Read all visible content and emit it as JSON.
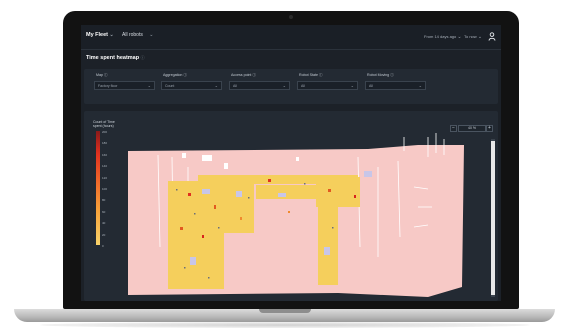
{
  "app": {
    "nav": {
      "fleet": "My Fleet",
      "robots": "All robots",
      "range_from": "From 14 days ago",
      "range_to": "To now"
    },
    "section_title": "Time spent heatmap",
    "filters": [
      {
        "label": "Map",
        "value": "Factory floor"
      },
      {
        "label": "Aggregation",
        "value": "Count"
      },
      {
        "label": "Access point",
        "value": "All"
      },
      {
        "label": "Robot State",
        "value": "All"
      },
      {
        "label": "Robot Moving",
        "value": "All"
      }
    ],
    "legend": {
      "title": "Count of Time spent (hours)",
      "ticks": [
        "200",
        "180",
        "160",
        "140",
        "120",
        "100",
        "80",
        "60",
        "40",
        "20",
        "0"
      ]
    },
    "zoom": {
      "minus": "−",
      "value": "40 %",
      "plus": "+"
    }
  },
  "colors": {
    "background": "#1c2128",
    "card": "#232a33",
    "map_area": "#f7c9c6",
    "heat_low": "#f7d26a",
    "heat_high": "#d8231c"
  },
  "icons": [
    "chevron-down-icon",
    "user-icon",
    "info-icon"
  ]
}
